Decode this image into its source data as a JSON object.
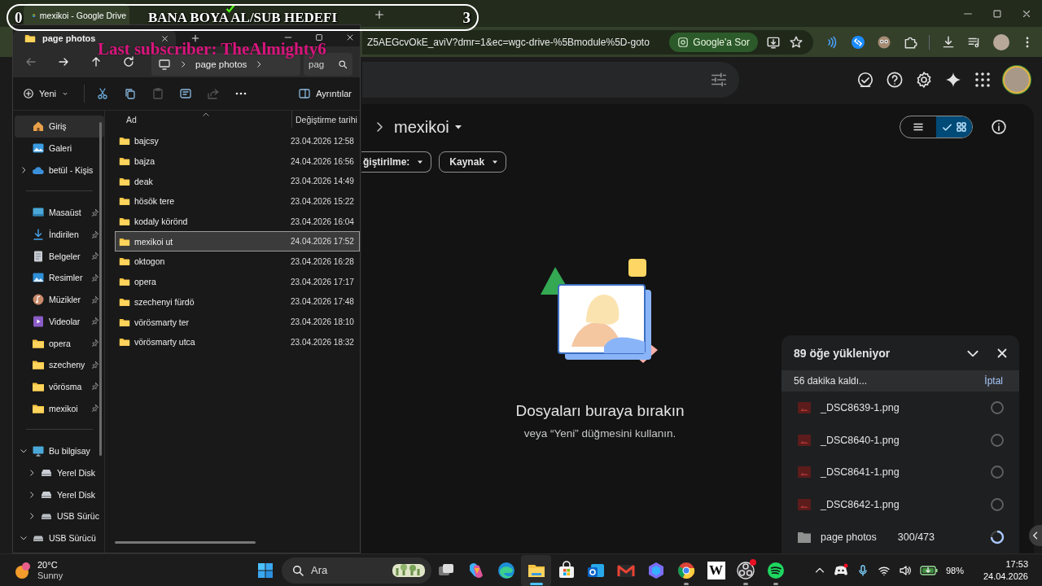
{
  "overlay": {
    "left_count": "0",
    "title": "BANA BOYA AL/SUB HEDEFI",
    "right_count": "3",
    "subscriber": "Last subscriber: TheAlmighty6"
  },
  "browser": {
    "tabs": [
      {
        "kind": "drive",
        "label": "mexikoi - Google Drive",
        "selected": true
      },
      {
        "kind": "kick",
        "selected": false
      }
    ],
    "address": "Z5AEGcvOkE_aviV?dmr=1&ec=wgc-drive-%5Bmodule%5D-goto",
    "ask_button": "Google'a Sor"
  },
  "drive": {
    "folder_title": "mexikoi",
    "filters": [
      "ğiştirilme:",
      "Kaynak"
    ],
    "view": [
      {
        "kind": "list",
        "selected": false
      },
      {
        "kind": "grid",
        "selected": true
      }
    ],
    "empty_title": "Dosyaları buraya bırakın",
    "empty_hint": "veya “Yeni” düğmesini kullanın."
  },
  "upload": {
    "title": "89 öğe yükleniyor",
    "remaining": "56 dakika kaldı...",
    "cancel": "İptal",
    "items": [
      {
        "kind": "image",
        "name": "_DSC8639-1.png",
        "in_progress": false
      },
      {
        "kind": "image",
        "name": "_DSC8640-1.png",
        "in_progress": false
      },
      {
        "kind": "image",
        "name": "_DSC8641-1.png",
        "in_progress": false
      },
      {
        "kind": "image",
        "name": "_DSC8642-1.png",
        "in_progress": false
      },
      {
        "kind": "folder",
        "name": "page photos",
        "count": "300/473",
        "in_progress": true
      }
    ]
  },
  "explorer": {
    "tab": "page photos",
    "breadcrumb": "page photos",
    "search_placeholder": "pag",
    "new_button": "Yeni",
    "details_button": "Ayrıntılar",
    "sidebar": [
      {
        "items": [
          {
            "kind": "home",
            "label": "Giriş",
            "selected": true,
            "expandable": false,
            "pinned": false
          },
          {
            "kind": "gallery",
            "label": "Galeri",
            "selected": false,
            "expandable": false,
            "pinned": false
          },
          {
            "kind": "cloud",
            "label": "betül - Kişis",
            "selected": false,
            "expandable": true,
            "expanded": false,
            "pinned": false
          }
        ]
      },
      {
        "items": [
          {
            "kind": "desktop",
            "label": "Masaüst",
            "selected": false,
            "expandable": false,
            "pinned": true
          },
          {
            "kind": "download",
            "label": "İndirilen",
            "selected": false,
            "expandable": false,
            "pinned": true
          },
          {
            "kind": "documents",
            "label": "Belgeler",
            "selected": false,
            "expandable": false,
            "pinned": true
          },
          {
            "kind": "pictures",
            "label": "Resimler",
            "selected": false,
            "expandable": false,
            "pinned": true
          },
          {
            "kind": "music",
            "label": "Müzikler",
            "selected": false,
            "expandable": false,
            "pinned": true
          },
          {
            "kind": "videos",
            "label": "Videolar",
            "selected": false,
            "expandable": false,
            "pinned": true
          },
          {
            "kind": "folder",
            "label": "opera",
            "selected": false,
            "expandable": false,
            "pinned": true
          },
          {
            "kind": "folder",
            "label": "szecheny",
            "selected": false,
            "expandable": false,
            "pinned": true
          },
          {
            "kind": "folder",
            "label": "vörösma",
            "selected": false,
            "expandable": false,
            "pinned": true
          },
          {
            "kind": "folder",
            "label": "mexikoi",
            "selected": false,
            "expandable": false,
            "pinned": true
          }
        ]
      },
      {
        "items": [
          {
            "kind": "computer",
            "label": "Bu bilgisay",
            "selected": false,
            "expandable": true,
            "expanded": true,
            "pinned": false,
            "children": [
              {
                "kind": "disk",
                "label": "Yerel Disk",
                "selected": false,
                "expandable": true,
                "expanded": false,
                "pinned": false
              },
              {
                "kind": "disk",
                "label": "Yerel Disk",
                "selected": false,
                "expandable": true,
                "expanded": false,
                "pinned": false
              },
              {
                "kind": "usb",
                "label": "USB Sürüc",
                "selected": false,
                "expandable": true,
                "expanded": false,
                "pinned": false
              }
            ]
          },
          {
            "kind": "usb",
            "label": "USB Sürücü",
            "selected": false,
            "expandable": true,
            "expanded": true,
            "pinned": false
          }
        ]
      }
    ],
    "columns": [
      "Ad",
      "Değiştirme tarihi"
    ],
    "rows": [
      {
        "name": "bajcsy",
        "date": "23.04.2026 12:58",
        "selected": false
      },
      {
        "name": "bajza",
        "date": "24.04.2026 16:56",
        "selected": false
      },
      {
        "name": "deak",
        "date": "23.04.2026 14:49",
        "selected": false
      },
      {
        "name": "hösök tere",
        "date": "23.04.2026 15:22",
        "selected": false
      },
      {
        "name": "kodaly körönd",
        "date": "23.04.2026 16:04",
        "selected": false
      },
      {
        "name": "mexikoi ut",
        "date": "24.04.2026 17:52",
        "selected": true
      },
      {
        "name": "oktogon",
        "date": "23.04.2026 16:28",
        "selected": false
      },
      {
        "name": "opera",
        "date": "23.04.2026 17:17",
        "selected": false
      },
      {
        "name": "szechenyi fürdö",
        "date": "23.04.2026 17:48",
        "selected": false
      },
      {
        "name": "vörösmarty ter",
        "date": "23.04.2026 18:10",
        "selected": false
      },
      {
        "name": "vörösmarty utca",
        "date": "23.04.2026 18:32",
        "selected": false
      }
    ]
  },
  "taskbar": {
    "weather": {
      "temp": "20°C",
      "condition": "Sunny"
    },
    "search_placeholder": "Ara",
    "apps": [
      {
        "kind": "task-view",
        "active": false,
        "running": false,
        "notification": false
      },
      {
        "kind": "copilot",
        "active": false,
        "running": false,
        "notification": false
      },
      {
        "kind": "edge",
        "active": false,
        "running": false,
        "notification": false
      },
      {
        "kind": "explorer",
        "active": true,
        "running": true,
        "notification": false
      },
      {
        "kind": "store",
        "active": false,
        "running": false,
        "notification": false
      },
      {
        "kind": "outlook",
        "active": false,
        "running": false,
        "notification": false
      },
      {
        "kind": "gmail",
        "active": false,
        "running": false,
        "notification": false
      },
      {
        "kind": "copilot-app",
        "active": false,
        "running": false,
        "notification": false
      },
      {
        "kind": "chrome",
        "active": false,
        "running": true,
        "notification": false
      },
      {
        "kind": "wikipedia",
        "glyph": "W",
        "active": false,
        "running": false,
        "notification": false
      },
      {
        "kind": "obs",
        "active": false,
        "running": true,
        "notification": true
      },
      {
        "kind": "spotify",
        "active": false,
        "running": true,
        "notification": false
      }
    ],
    "battery": "98%",
    "time": "17:53",
    "date": "24.04.2026"
  }
}
